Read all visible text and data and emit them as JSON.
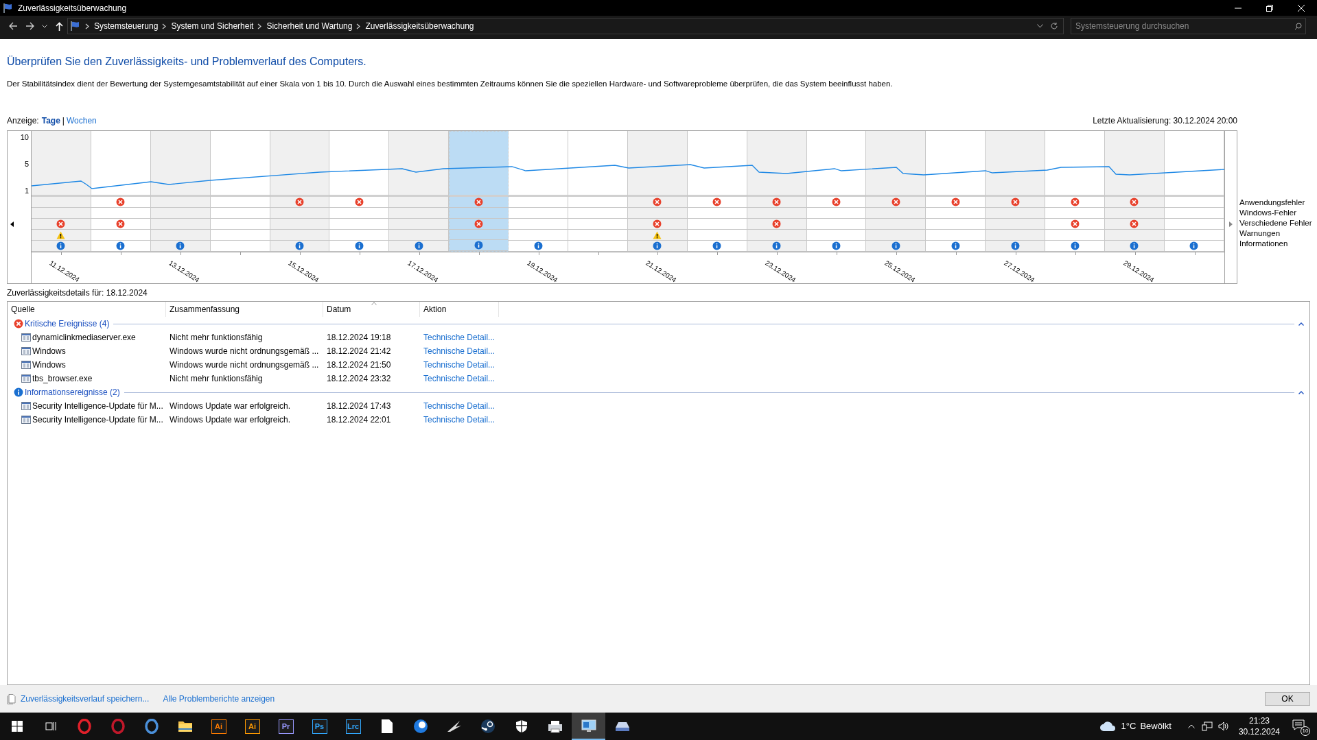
{
  "window": {
    "title": "Zuverlässigkeitsüberwachung"
  },
  "address_bar": {
    "breadcrumbs": [
      "Systemsteuerung",
      "System und Sicherheit",
      "Sicherheit und Wartung",
      "Zuverlässigkeitsüberwachung"
    ],
    "search": {
      "placeholder": "Systemsteuerung durchsuchen"
    }
  },
  "heading": "Überprüfen Sie den Zuverlässigkeits- und Problemverlauf des Computers.",
  "description": "Der Stabilitätsindex dient der Bewertung der Systemgesamtstabilität auf einer Skala von 1 bis 10. Durch die Auswahl eines bestimmten Zeitraums können Sie die speziellen Hardware- und Softwareprobleme überprüfen, die das System beeinflusst haben.",
  "view": {
    "label": "Anzeige:",
    "options": [
      {
        "label": "Tage",
        "selected": true
      },
      {
        "label": "Wochen",
        "selected": false
      }
    ],
    "separator": "|"
  },
  "last_update": "Letzte Aktualisierung: 30.12.2024 20:00",
  "chart": {
    "y_axis_labels": [
      "10",
      "5",
      "1"
    ],
    "days": [
      {
        "label": "11.12.2024",
        "shaded": true,
        "selected": false
      },
      {
        "shaded": false,
        "selected": false
      },
      {
        "label": "13.12.2024",
        "shaded": true,
        "selected": false
      },
      {
        "shaded": false,
        "selected": false
      },
      {
        "label": "15.12.2024",
        "shaded": true,
        "selected": false
      },
      {
        "shaded": false,
        "selected": false
      },
      {
        "label": "17.12.2024",
        "shaded": true,
        "selected": false
      },
      {
        "selected": true
      },
      {
        "label": "19.12.2024",
        "shaded": false,
        "selected": false
      },
      {
        "shaded": false,
        "selected": false
      },
      {
        "label": "21.12.2024",
        "shaded": true,
        "selected": false
      },
      {
        "shaded": false,
        "selected": false
      },
      {
        "label": "23.12.2024",
        "shaded": true,
        "selected": false
      },
      {
        "shaded": false,
        "selected": false
      },
      {
        "label": "25.12.2024",
        "shaded": true,
        "selected": false
      },
      {
        "shaded": false,
        "selected": false
      },
      {
        "label": "27.12.2024",
        "shaded": true,
        "selected": false
      },
      {
        "shaded": false,
        "selected": false
      },
      {
        "label": "29.12.2024",
        "shaded": true,
        "selected": false
      },
      {
        "shaded": false,
        "selected": false
      }
    ],
    "event_rows": [
      {
        "label": "Anwendungsfehler",
        "kind": "error",
        "days": [
          false,
          true,
          false,
          false,
          true,
          true,
          false,
          true,
          false,
          false,
          true,
          true,
          true,
          true,
          true,
          true,
          true,
          true,
          true,
          false
        ]
      },
      {
        "label": "Windows-Fehler"
      },
      {
        "label": "Verschiedene Fehler",
        "kind": "error",
        "days": [
          true,
          true,
          false,
          false,
          false,
          false,
          false,
          true,
          false,
          false,
          true,
          false,
          true,
          false,
          false,
          false,
          false,
          true,
          true,
          false
        ]
      },
      {
        "label": "Warnungen",
        "kind": "warning",
        "days": [
          true,
          false,
          false,
          false,
          false,
          false,
          false,
          false,
          false,
          false,
          true,
          false,
          false,
          false,
          false,
          false,
          false,
          false,
          false,
          false
        ]
      },
      {
        "label": "Informationen",
        "kind": "info",
        "days": [
          true,
          true,
          true,
          false,
          true,
          true,
          true,
          true,
          true,
          false,
          true,
          true,
          true,
          true,
          true,
          true,
          true,
          true,
          true,
          true
        ]
      }
    ]
  },
  "details": {
    "title": "Zuverlässigkeitsdetails für: 18.12.2024",
    "columns": [
      {
        "label": "Quelle",
        "sorted": false
      },
      {
        "label": "Zusammenfassung",
        "sorted": false
      },
      {
        "label": "Datum",
        "sorted": true
      },
      {
        "label": "Aktion",
        "sorted": false
      }
    ],
    "groups": [
      {
        "title": "Kritische Ereignisse (4)",
        "kind": "critical",
        "expanded": true,
        "rows": [
          {
            "source": "dynamiclinkmediaserver.exe",
            "summary": "Nicht mehr funktionsfähig",
            "date": "18.12.2024 19:18",
            "action": "Technische Detail..."
          },
          {
            "source": "Windows",
            "summary": "Windows wurde nicht ordnungsgemäß ...",
            "date": "18.12.2024 21:42",
            "action": "Technische Detail..."
          },
          {
            "source": "Windows",
            "summary": "Windows wurde nicht ordnungsgemäß ...",
            "date": "18.12.2024 21:50",
            "action": "Technische Detail..."
          },
          {
            "source": "tbs_browser.exe",
            "summary": "Nicht mehr funktionsfähig",
            "date": "18.12.2024 23:32",
            "action": "Technische Detail..."
          }
        ]
      },
      {
        "title": "Informationsereignisse (2)",
        "kind": "info",
        "expanded": true,
        "rows": [
          {
            "source": "Security Intelligence-Update für M...",
            "summary": "Windows Update war erfolgreich.",
            "date": "18.12.2024 17:43",
            "action": "Technische Detail..."
          },
          {
            "source": "Security Intelligence-Update für M...",
            "summary": "Windows Update war erfolgreich.",
            "date": "18.12.2024 22:01",
            "action": "Technische Detail..."
          }
        ]
      }
    ]
  },
  "footer": {
    "links": [
      "Zuverlässigkeitsverlauf speichern...",
      "Alle Problemberichte anzeigen"
    ],
    "ok_button": "OK"
  },
  "taskbar": {
    "apps": [
      {
        "kind": "start",
        "selected": false
      },
      {
        "kind": "taskview",
        "selected": false
      },
      {
        "kind": "ring",
        "color": "#e0202a",
        "selected": false
      },
      {
        "kind": "ring",
        "color": "#c0182a",
        "selected": false
      },
      {
        "kind": "ring",
        "color": "#4a8fd9",
        "selected": false
      },
      {
        "kind": "folder",
        "selected": false
      },
      {
        "kind": "text",
        "text": "Ai",
        "color": "#ff7c00",
        "selected": false
      },
      {
        "kind": "text",
        "text": "Ai",
        "color": "#ff9a00",
        "selected": false
      },
      {
        "kind": "text",
        "text": "Pr",
        "color": "#9999ff",
        "selected": false
      },
      {
        "kind": "text",
        "text": "Ps",
        "color": "#31a8ff",
        "selected": false
      },
      {
        "kind": "text",
        "text": "Lrc",
        "color": "#31a8ff",
        "selected": false
      },
      {
        "kind": "page",
        "selected": false
      },
      {
        "kind": "disc",
        "color": "#1f7ae0",
        "selected": false
      },
      {
        "kind": "bird",
        "selected": false
      },
      {
        "kind": "steam",
        "selected": false
      },
      {
        "kind": "shield",
        "selected": false
      },
      {
        "kind": "printer",
        "selected": false
      },
      {
        "kind": "monitor",
        "selected": true
      },
      {
        "kind": "drive",
        "selected": false
      }
    ],
    "weather": {
      "temp": "1°C",
      "condition": "Bewölkt"
    },
    "time": "21:23",
    "date": "30.12.2024",
    "notifications": "10"
  }
}
